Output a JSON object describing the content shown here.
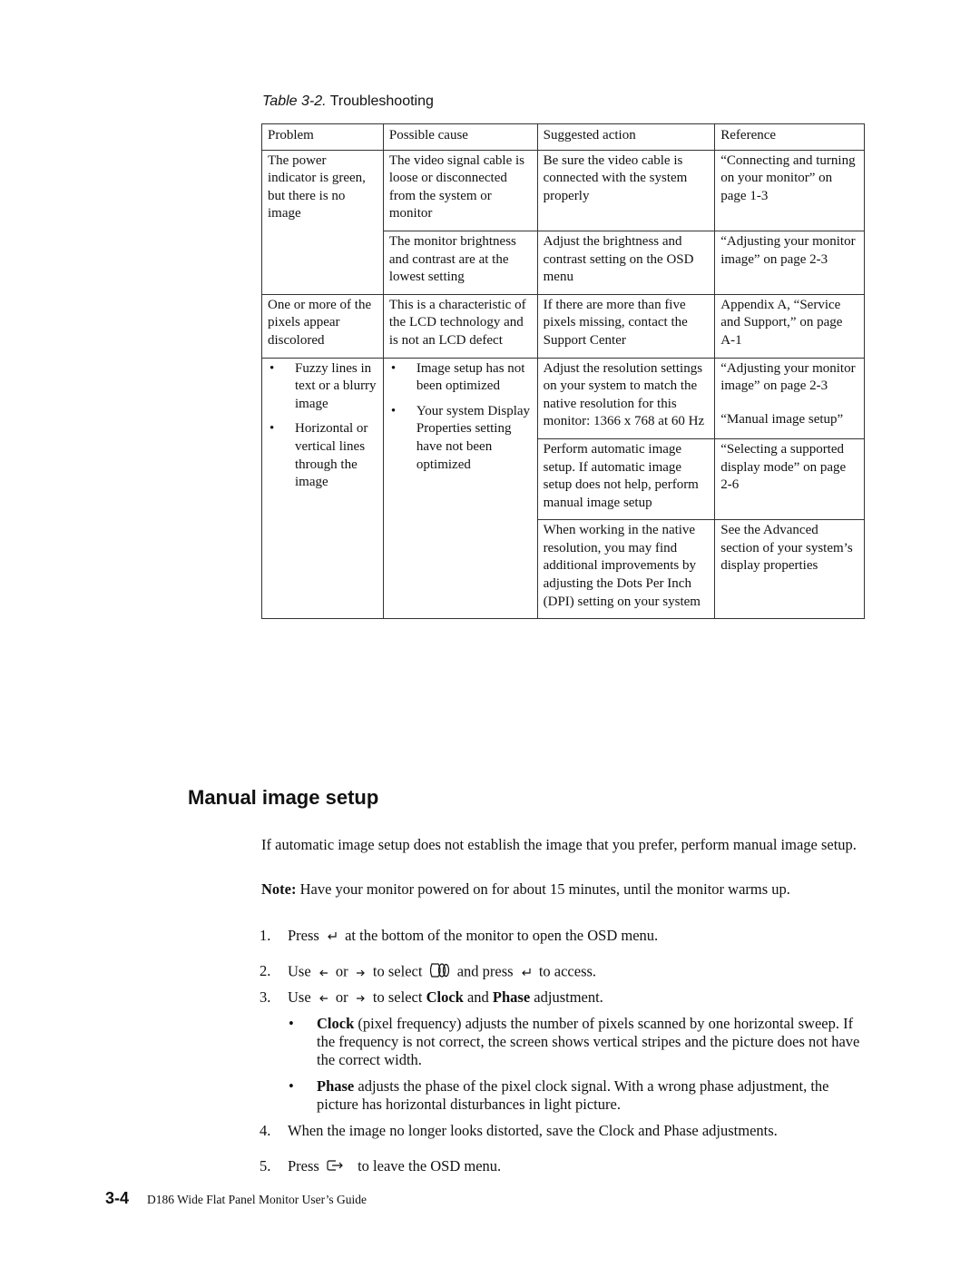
{
  "table": {
    "caption_prefix": "Table 3-2.",
    "caption_title": "Troubleshooting",
    "headers": [
      "Problem",
      "Possible cause",
      "Suggested action",
      "Reference"
    ],
    "rows": [
      {
        "problem": "The power indicator is green, but there is no image",
        "causes": [
          {
            "cause": "The video signal cable is loose or disconnected from the system or monitor",
            "action": "Be sure the video cable is connected with the system properly",
            "reference": "“Connecting and turning on your monitor” on page 1-3"
          },
          {
            "cause": "The monitor brightness and contrast are at the lowest setting",
            "action": "Adjust the brightness and contrast setting on the OSD menu",
            "reference": "“Adjusting your monitor image” on page 2-3"
          }
        ]
      },
      {
        "problem": "One or more of the pixels appear discolored",
        "causes": [
          {
            "cause": "This is a characteristic of the LCD technology and is not an LCD defect",
            "action": "If there are more than five pixels missing, contact the Support Center",
            "reference": "Appendix A, “Service and Support,” on page A-1"
          }
        ]
      },
      {
        "problem_bullets": [
          "Fuzzy lines in text or a blurry image",
          "Horizontal or vertical lines through the image"
        ],
        "cause_bullets": [
          "Image setup has not been optimized",
          "Your system Display Properties setting have not been optimized"
        ],
        "actions": [
          {
            "action": "Adjust the resolution settings on your system to match the native resolution for this monitor: 1366 x 768 at 60 Hz",
            "references": [
              "“Adjusting your monitor image” on page 2-3",
              "“Manual image setup”"
            ]
          },
          {
            "action": "Perform automatic image setup.  If automatic image setup does not help, perform manual image setup",
            "references": [
              "“Selecting a supported display mode” on page 2-6"
            ]
          },
          {
            "action": "When working in the native resolution, you may find additional improvements by adjusting the Dots Per Inch (DPI) setting on your system",
            "references": [
              "See the Advanced section of your system’s display properties"
            ]
          }
        ]
      }
    ]
  },
  "section": {
    "title": "Manual image setup",
    "intro": "If automatic image setup does not establish the image that you prefer, perform manual image setup.",
    "note_label": "Note:",
    "note_text": " Have your monitor powered on for about 15 minutes, until the monitor warms up.",
    "steps": {
      "s1": {
        "num": "1.",
        "a": "Press",
        "b": "at the bottom of the monitor to open the OSD menu."
      },
      "s2": {
        "num": "2.",
        "a": "Use",
        "or": "or",
        "b": "to select",
        "c": "and press",
        "d": "to access."
      },
      "s3": {
        "num": "3.",
        "a": "Use",
        "or": "or",
        "b": "to select",
        "clock": "Clock",
        "and": "and",
        "phase": "Phase",
        "c": "adjustment."
      },
      "s4": {
        "num": "4.",
        "text": "When the image no longer looks distorted, save the Clock and Phase adjustments."
      },
      "s5": {
        "num": "5.",
        "a": "Press",
        "b": "to leave the OSD menu."
      }
    },
    "bullets": {
      "clock_label": "Clock",
      "clock_text": " (pixel frequency) adjusts the number of pixels scanned by one horizontal sweep. If the frequency is not correct, the screen shows vertical stripes and the picture does not have the correct width.",
      "phase_label": "Phase",
      "phase_text": " adjusts the phase of the pixel clock signal. With a wrong phase adjustment, the picture has horizontal disturbances in light picture."
    },
    "bullet_glyph": "•"
  },
  "footer": {
    "page_number": "3-4",
    "title": "D186 Wide Flat Panel Monitor User’s Guide"
  },
  "icons": {
    "enter": "enter-icon",
    "left_arrow": "left-arrow-icon",
    "right_arrow": "right-arrow-icon",
    "image_setup": "image-setup-icon",
    "exit": "exit-icon"
  }
}
